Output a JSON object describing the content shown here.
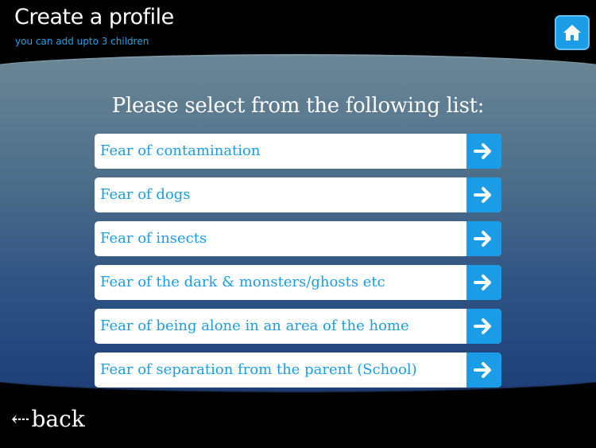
{
  "header": {
    "title": "Create a profile",
    "subtitle": "you can add upto 3 children",
    "home_icon": "home-icon"
  },
  "main": {
    "heading": "Please select from the following list:",
    "options": [
      {
        "label": "Fear of contamination",
        "icon": "arrow-right-icon"
      },
      {
        "label": "Fear of dogs",
        "icon": "arrow-right-icon"
      },
      {
        "label": "Fear of insects",
        "icon": "arrow-right-icon"
      },
      {
        "label": "Fear of the dark & monsters/ghosts etc",
        "icon": "arrow-right-icon"
      },
      {
        "label": "Fear of being alone in an area of the home",
        "icon": "arrow-right-icon"
      },
      {
        "label": "Fear of separation from the parent (School)",
        "icon": "arrow-right-icon"
      }
    ]
  },
  "footer": {
    "back_label": "back",
    "back_glyph": "⇠"
  },
  "colors": {
    "accent": "#1a9de6",
    "background": "#000000",
    "panel_top": "#6b8796",
    "panel_bottom": "#1e3f79",
    "text_light": "#ffffff"
  }
}
